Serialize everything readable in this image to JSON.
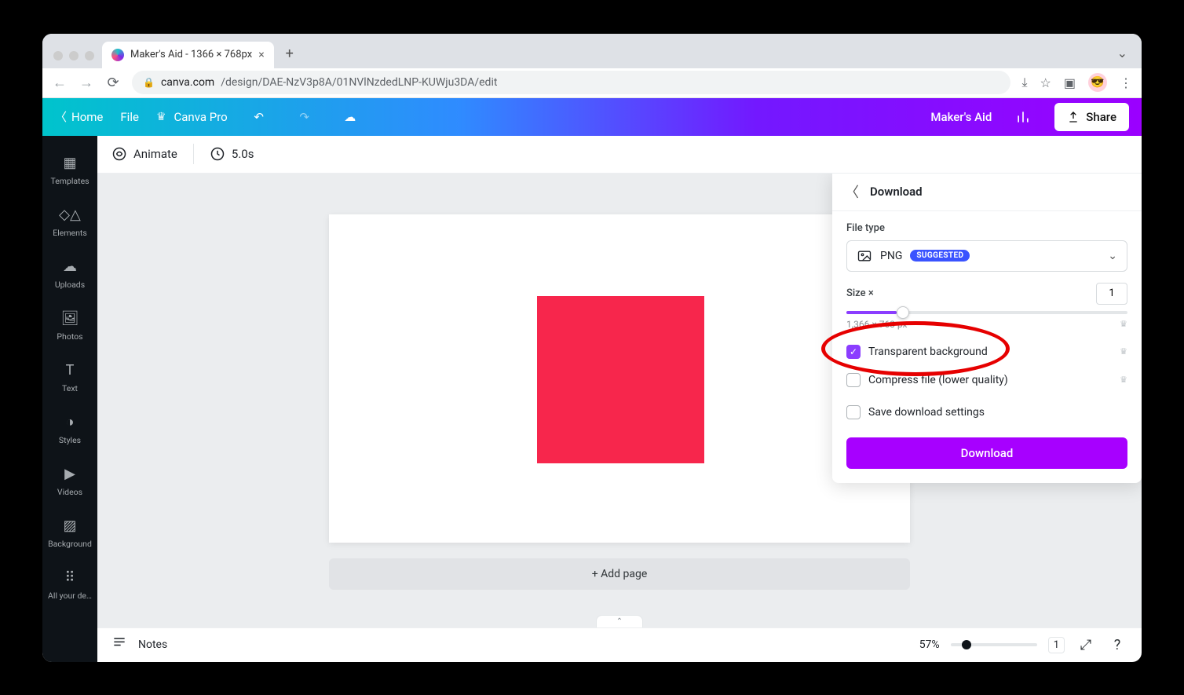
{
  "browser": {
    "tab_title": "Maker's Aid - 1366 × 768px",
    "url_domain": "canva.com",
    "url_path": "/design/DAE-NzV3p8A/01NVlNzdedLNP-KUWju3DA/edit"
  },
  "topbar": {
    "home": "Home",
    "file": "File",
    "pro": "Canva Pro",
    "doc_title": "Maker's Aid",
    "share": "Share"
  },
  "sidebar": {
    "items": [
      {
        "label": "Templates"
      },
      {
        "label": "Elements"
      },
      {
        "label": "Uploads"
      },
      {
        "label": "Photos"
      },
      {
        "label": "Text"
      },
      {
        "label": "Styles"
      },
      {
        "label": "Videos"
      },
      {
        "label": "Background"
      },
      {
        "label": "All your de…"
      }
    ]
  },
  "contextbar": {
    "animate": "Animate",
    "duration": "5.0s"
  },
  "canvas": {
    "add_page": "+ Add page"
  },
  "bottombar": {
    "notes": "Notes",
    "zoom": "57%",
    "page_count": "1"
  },
  "download": {
    "title": "Download",
    "file_type_label": "File type",
    "file_type_value": "PNG",
    "file_type_badge": "SUGGESTED",
    "size_label": "Size ×",
    "size_value": "1",
    "dimensions": "1,366 × 768 px",
    "opt_transparent": "Transparent background",
    "opt_compress": "Compress file (lower quality)",
    "opt_save": "Save download settings",
    "button": "Download"
  }
}
